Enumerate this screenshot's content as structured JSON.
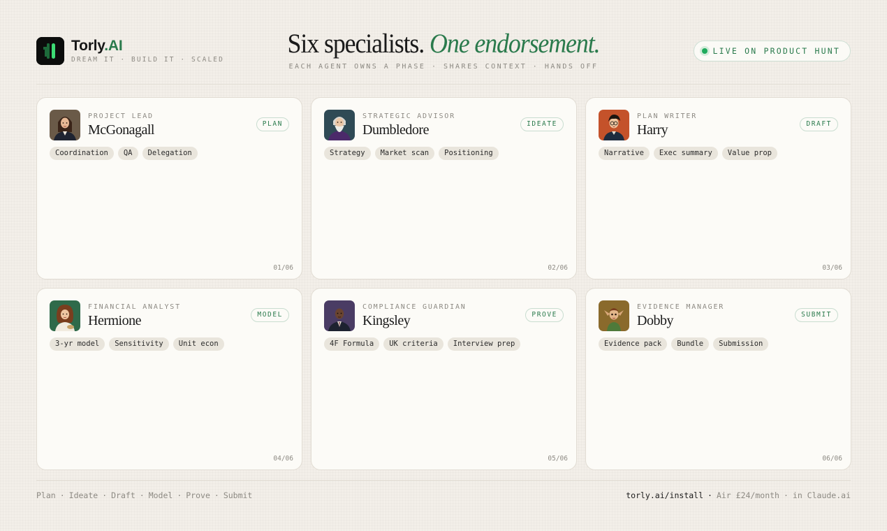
{
  "brand": {
    "name": "Torly",
    "dot": ".",
    "suffix": "AI",
    "tagline": "DREAM IT · BUILD IT · SCALED"
  },
  "headline": {
    "main": "Six specialists.",
    "emphasis": "One endorsement.",
    "subtitle": "EACH AGENT OWNS A PHASE · SHARES CONTEXT · HANDS OFF"
  },
  "live_badge": {
    "label": "LIVE ON PRODUCT HUNT"
  },
  "agents": [
    {
      "role": "PROJECT LEAD",
      "name": "McGonagall",
      "phase": "PLAN",
      "tags": [
        "Coordination",
        "QA",
        "Delegation"
      ],
      "index": "01/06",
      "avatar_bg": "#6a5a48"
    },
    {
      "role": "STRATEGIC ADVISOR",
      "name": "Dumbledore",
      "phase": "IDEATE",
      "tags": [
        "Strategy",
        "Market scan",
        "Positioning"
      ],
      "index": "02/06",
      "avatar_bg": "#2f4a55"
    },
    {
      "role": "PLAN WRITER",
      "name": "Harry",
      "phase": "DRAFT",
      "tags": [
        "Narrative",
        "Exec summary",
        "Value prop"
      ],
      "index": "03/06",
      "avatar_bg": "#c4522a"
    },
    {
      "role": "FINANCIAL ANALYST",
      "name": "Hermione",
      "phase": "MODEL",
      "tags": [
        "3-yr model",
        "Sensitivity",
        "Unit econ"
      ],
      "index": "04/06",
      "avatar_bg": "#2f6a4a"
    },
    {
      "role": "COMPLIANCE GUARDIAN",
      "name": "Kingsley",
      "phase": "PROVE",
      "tags": [
        "4F Formula",
        "UK criteria",
        "Interview prep"
      ],
      "index": "05/06",
      "avatar_bg": "#4a3c64"
    },
    {
      "role": "EVIDENCE MANAGER",
      "name": "Dobby",
      "phase": "SUBMIT",
      "tags": [
        "Evidence pack",
        "Bundle",
        "Submission"
      ],
      "index": "06/06",
      "avatar_bg": "#8a6a2c"
    }
  ],
  "footer": {
    "phases": [
      "Plan",
      "Ideate",
      "Draft",
      "Model",
      "Prove",
      "Submit"
    ],
    "separator": "·",
    "url": "torly.ai/install",
    "price": "Air £24/month",
    "platform": "in Claude.ai"
  },
  "colors": {
    "accent": "#2a7a4c",
    "live_dot": "#1faa5c",
    "background": "#f3efe9",
    "card": "#fcfbf7"
  }
}
